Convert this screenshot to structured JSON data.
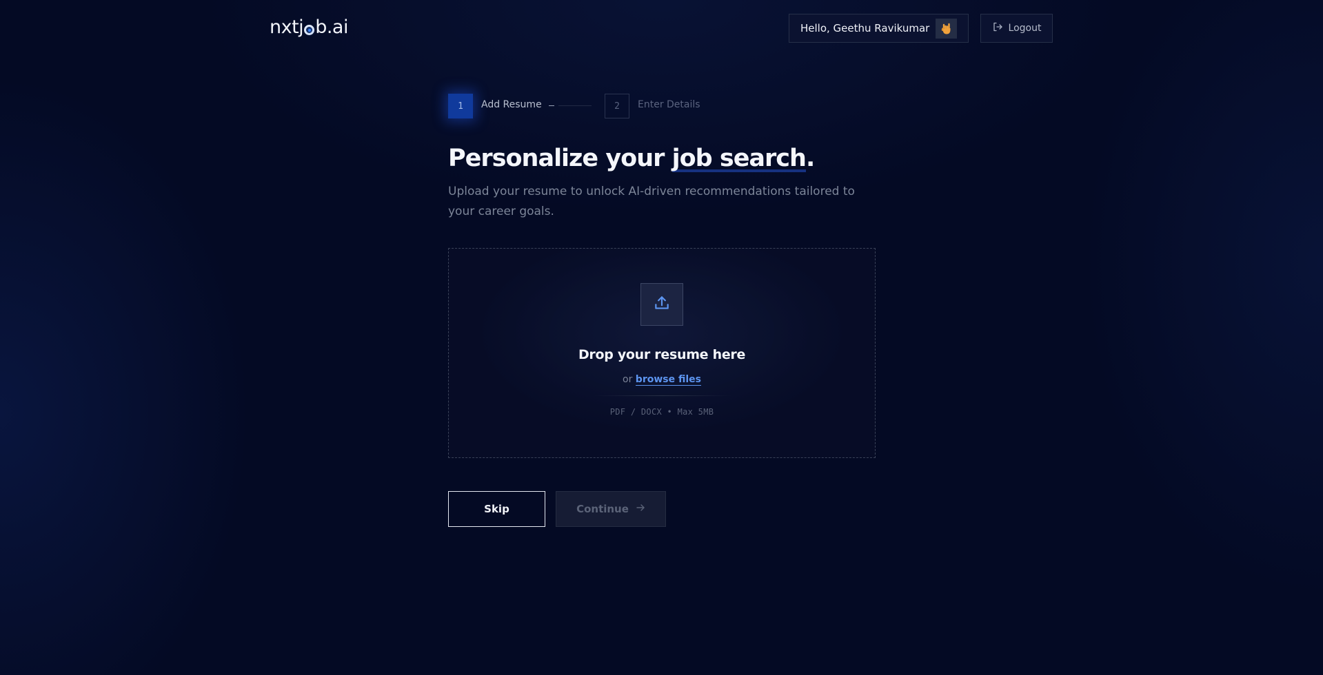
{
  "header": {
    "logo_prefix": "nxtj",
    "logo_suffix": "b.ai",
    "greeting": "Hello, Geethu Ravikumar",
    "greeting_emoji_icon": "rock-hand-icon",
    "logout_label": "Logout"
  },
  "stepper": {
    "steps": [
      {
        "number": "1",
        "label": "Add Resume",
        "active": true
      },
      {
        "number": "2",
        "label": "Enter Details",
        "active": false
      }
    ]
  },
  "hero": {
    "title_prefix": "Personalize your ",
    "title_highlight": "job search",
    "title_suffix": ".",
    "subtitle": "Upload your resume to unlock AI-driven recommendations tailored to your career goals."
  },
  "dropzone": {
    "icon": "upload-icon",
    "title": "Drop your resume here",
    "or_text": "or",
    "browse_label": "browse files",
    "formats": "PDF / DOCX • Max 5MB"
  },
  "actions": {
    "skip_label": "Skip",
    "continue_label": "Continue",
    "continue_disabled": true
  },
  "colors": {
    "background": "#040a24",
    "accent": "#3b82f6",
    "step_active": "#103a9c",
    "link": "#5d95f0"
  }
}
